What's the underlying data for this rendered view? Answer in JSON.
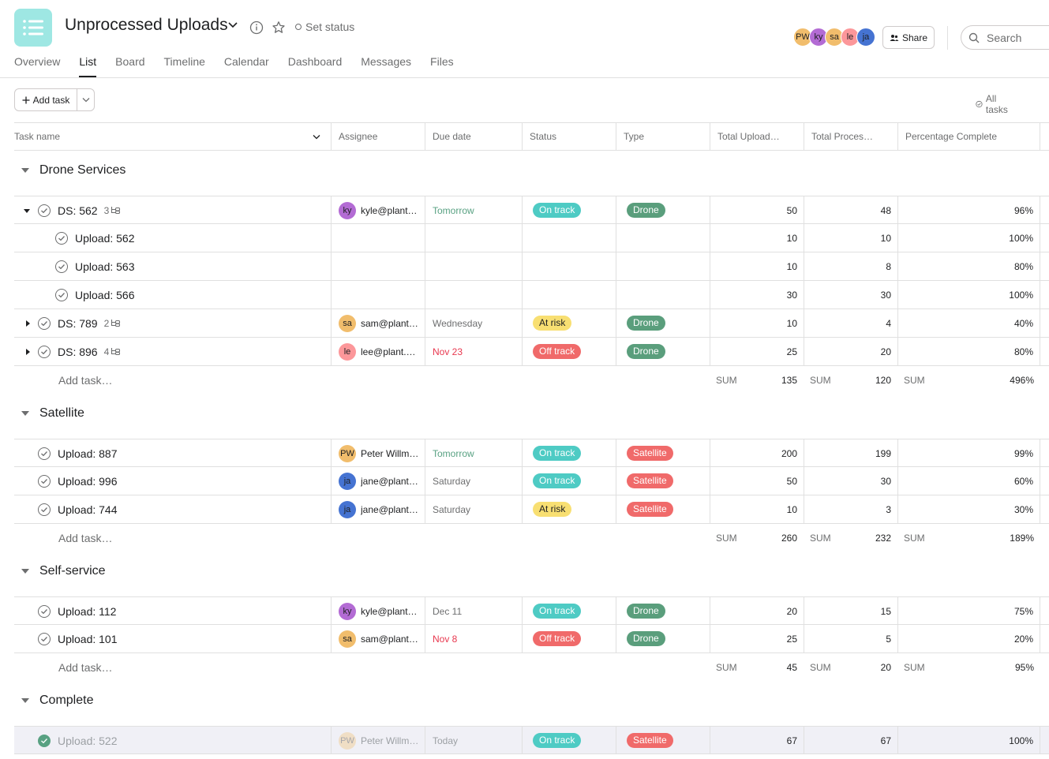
{
  "project": {
    "title": "Unprocessed Uploads",
    "set_status_label": "Set status",
    "accent_color": "#9ee7e3"
  },
  "tabs": [
    "Overview",
    "List",
    "Board",
    "Timeline",
    "Calendar",
    "Dashboard",
    "Messages",
    "Files"
  ],
  "active_tab": "List",
  "members": [
    {
      "initials": "PW",
      "color": "#f1bd6c"
    },
    {
      "initials": "ky",
      "color": "#b36bd4"
    },
    {
      "initials": "sa",
      "color": "#f1bd6c"
    },
    {
      "initials": "le",
      "color": "#fc979a"
    },
    {
      "initials": "ja",
      "color": "#4573d2"
    }
  ],
  "share_label": "Share",
  "search_placeholder": "Search",
  "toolbar": {
    "add_task_label": "Add task",
    "all_tasks_label": "All tasks"
  },
  "columns": {
    "task_name": "Task name",
    "assignee": "Assignee",
    "due_date": "Due date",
    "status": "Status",
    "type": "Type",
    "total_uploaded": "Total Upload…",
    "total_processed": "Total Proces…",
    "percentage": "Percentage Complete"
  },
  "add_task_row_label": "Add task…",
  "sum_label": "SUM",
  "sections": [
    {
      "name": "Drone Services",
      "sums": {
        "uploaded": "135",
        "processed": "120",
        "percentage": "496%"
      }
    },
    {
      "name": "Satellite",
      "sums": {
        "uploaded": "260",
        "processed": "232",
        "percentage": "189%"
      }
    },
    {
      "name": "Self-service",
      "sums": {
        "uploaded": "45",
        "processed": "20",
        "percentage": "95%"
      }
    },
    {
      "name": "Complete"
    }
  ],
  "rows": [
    {
      "name": "DS: 562",
      "subtasks": "3",
      "assignee_initials": "ky",
      "assignee_color": "#b36bd4",
      "assignee": "kyle@plant…",
      "due": "Tomorrow",
      "due_color": "#58a182",
      "status": "On track",
      "type": "Drone",
      "uploaded": "50",
      "processed": "48",
      "pct": "96%"
    },
    {
      "name": "Upload: 562",
      "uploaded": "10",
      "processed": "10",
      "pct": "100%"
    },
    {
      "name": "Upload: 563",
      "uploaded": "10",
      "processed": "8",
      "pct": "80%"
    },
    {
      "name": "Upload: 566",
      "uploaded": "30",
      "processed": "30",
      "pct": "100%"
    },
    {
      "name": "DS: 789",
      "subtasks": "2",
      "assignee_initials": "sa",
      "assignee_color": "#f1bd6c",
      "assignee": "sam@plant…",
      "due": "Wednesday",
      "due_color": "#6d6e6f",
      "status": "At risk",
      "type": "Drone",
      "uploaded": "10",
      "processed": "4",
      "pct": "40%"
    },
    {
      "name": "DS: 896",
      "subtasks": "4",
      "assignee_initials": "le",
      "assignee_color": "#fc979a",
      "assignee": "lee@plant.…",
      "due": "Nov 23",
      "due_color": "#e8384f",
      "status": "Off track",
      "type": "Drone",
      "uploaded": "25",
      "processed": "20",
      "pct": "80%"
    },
    {
      "name": "Upload: 887",
      "assignee_initials": "PW",
      "assignee_color": "#f1bd6c",
      "assignee": "Peter Willm…",
      "due": "Tomorrow",
      "due_color": "#58a182",
      "status": "On track",
      "type": "Satellite",
      "uploaded": "200",
      "processed": "199",
      "pct": "99%"
    },
    {
      "name": "Upload: 996",
      "assignee_initials": "ja",
      "assignee_color": "#4573d2",
      "assignee": "jane@plant…",
      "due": "Saturday",
      "due_color": "#6d6e6f",
      "status": "On track",
      "type": "Satellite",
      "uploaded": "50",
      "processed": "30",
      "pct": "60%"
    },
    {
      "name": "Upload: 744",
      "assignee_initials": "ja",
      "assignee_color": "#4573d2",
      "assignee": "jane@plant…",
      "due": "Saturday",
      "due_color": "#6d6e6f",
      "status": "At risk",
      "type": "Satellite",
      "uploaded": "10",
      "processed": "3",
      "pct": "30%"
    },
    {
      "name": "Upload: 112",
      "assignee_initials": "ky",
      "assignee_color": "#b36bd4",
      "assignee": "kyle@plant…",
      "due": "Dec 11",
      "due_color": "#6d6e6f",
      "status": "On track",
      "type": "Drone",
      "uploaded": "20",
      "processed": "15",
      "pct": "75%"
    },
    {
      "name": "Upload: 101",
      "assignee_initials": "sa",
      "assignee_color": "#f1bd6c",
      "assignee": "sam@plant…",
      "due": "Nov 8",
      "due_color": "#e8384f",
      "status": "Off track",
      "type": "Drone",
      "uploaded": "25",
      "processed": "5",
      "pct": "20%"
    },
    {
      "name": "Upload: 522",
      "assignee_initials": "PW",
      "assignee_color": "#f1bd6c",
      "assignee": "Peter Willm…",
      "due": "Today",
      "due_color": "#6d6e6f",
      "status": "On track",
      "type": "Satellite",
      "uploaded": "67",
      "processed": "67",
      "pct": "100%"
    }
  ],
  "status_colors": {
    "On track": "#4ecbc4",
    "At risk": "#f8df72",
    "Off track": "#f06a6a"
  },
  "type_colors": {
    "Drone": "#5a9e7c",
    "Satellite": "#f06a6a"
  }
}
